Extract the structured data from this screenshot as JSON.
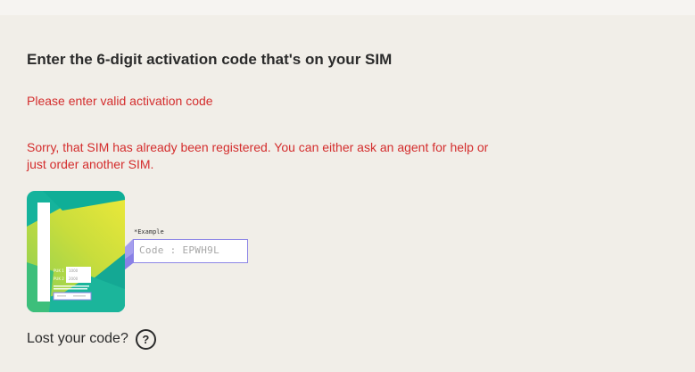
{
  "form": {
    "heading": "Enter the 6-digit activation code that's on your SIM",
    "errors": [
      "Please enter valid activation code",
      "Sorry, that SIM has already been registered. You can either ask an agent for help or just order another SIM."
    ]
  },
  "illustration": {
    "example_label": "*Example",
    "code_text": "Code : EPWH9L",
    "card_small_labels": [
      "PUK 1",
      "PUK 2"
    ],
    "card_small_values": [
      "1000",
      "2000"
    ]
  },
  "help": {
    "label": "Lost your code?",
    "icon": "question-circle-icon",
    "icon_glyph": "?"
  },
  "colors": {
    "background": "#f1eee8",
    "error": "#d42d2d",
    "accent": "#8d86e6",
    "sim_teal": "#0fb7a0",
    "sim_yellow": "#e3e63a"
  }
}
